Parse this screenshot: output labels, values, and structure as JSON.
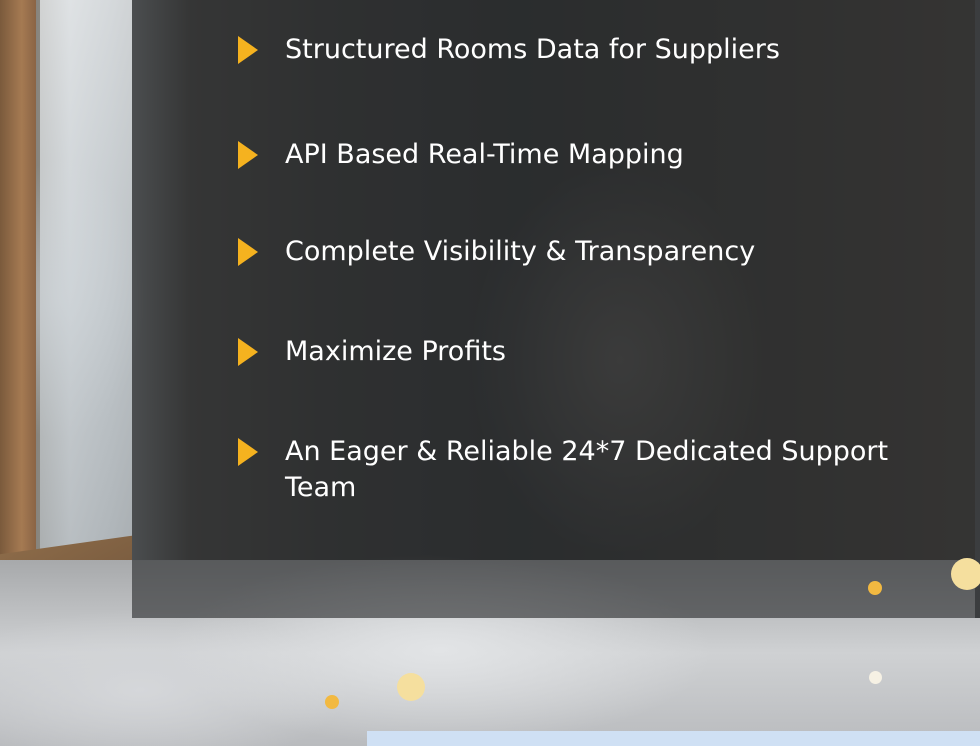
{
  "features": [
    "Structured Rooms Data for Suppliers",
    "API Based Real-Time Mapping",
    "Complete Visibility & Transparency",
    "Maximize Profits",
    "An Eager & Reliable 24*7 Dedicated Support Team"
  ],
  "colors": {
    "arrow": "#f5b21f",
    "overlay": "rgba(40,42,44,0.62)",
    "text": "#ffffff",
    "dot_gold": "#f2b941",
    "dot_cream": "#f5df9e",
    "dot_white": "#f6f1e4",
    "bottom_bar": "#cfe0f4"
  },
  "icons": {
    "bullet": "play-arrow-icon"
  }
}
